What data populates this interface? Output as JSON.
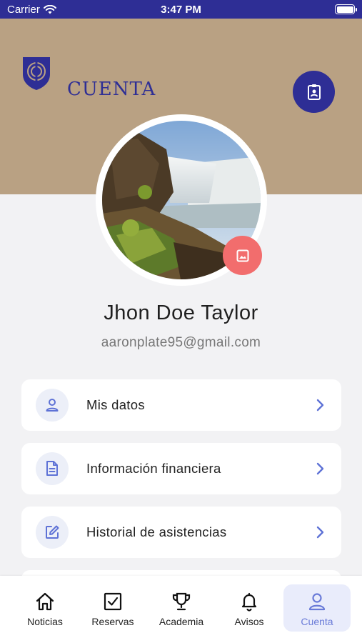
{
  "status_bar": {
    "carrier": "Carrier",
    "time": "3:47 PM"
  },
  "header": {
    "title": "CUENTA"
  },
  "profile": {
    "name": "Jhon Doe Taylor",
    "email": "aaronplate95@gmail.com"
  },
  "menu": [
    {
      "label": "Mis datos",
      "icon": "person-icon"
    },
    {
      "label": "Información financiera",
      "icon": "document-icon"
    },
    {
      "label": "Historial de asistencias",
      "icon": "edit-icon"
    }
  ],
  "tabs": [
    {
      "label": "Noticias",
      "icon": "home-icon"
    },
    {
      "label": "Reservas",
      "icon": "checkbox-icon"
    },
    {
      "label": "Academia",
      "icon": "trophy-icon"
    },
    {
      "label": "Avisos",
      "icon": "bell-icon"
    },
    {
      "label": "Cuenta",
      "icon": "user-icon",
      "active": true
    }
  ],
  "colors": {
    "primary": "#2e2e95",
    "header_bg": "#b9a183",
    "accent": "#f26d6d",
    "active_tab": "#6a7bd8"
  }
}
